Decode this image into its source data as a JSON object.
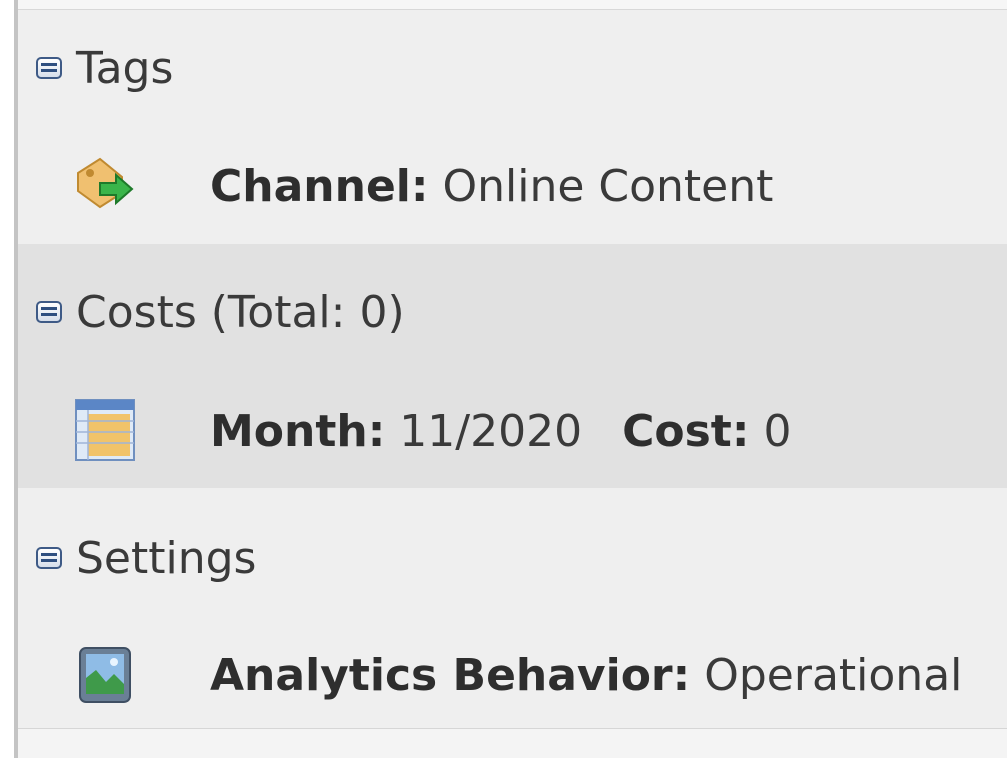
{
  "sections": {
    "tags": {
      "header": "Tags",
      "item_icon": "tag-arrow-icon",
      "item_key": "Channel:",
      "item_value": "Online Content"
    },
    "costs": {
      "header": "Costs (Total: 0)",
      "item_icon": "calendar-icon",
      "month_key": "Month:",
      "month_value": "11/2020",
      "cost_key": "Cost:",
      "cost_value": "0"
    },
    "settings": {
      "header": "Settings",
      "item_icon": "analytics-image-icon",
      "item_key": "Analytics Behavior:",
      "item_value": "Operational"
    }
  },
  "icons": {
    "collapse": "collapse-icon"
  },
  "colors": {
    "panel_bg": "#efefef",
    "highlight_bg": "#e1e1e1",
    "collapse_icon": "#3e5a86"
  }
}
